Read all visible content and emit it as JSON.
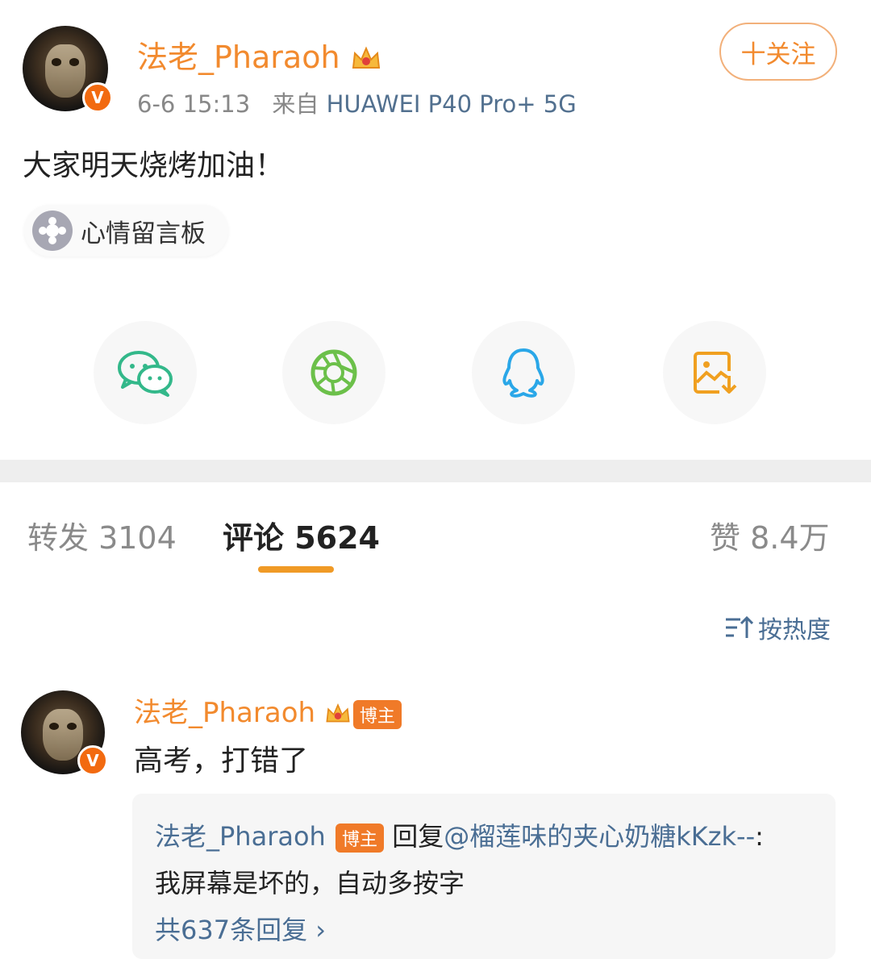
{
  "post": {
    "author": "法老_Pharaoh",
    "time": "6-6 15:13",
    "source_prefix": "来自",
    "device": "HUAWEI P40 Pro+ 5G",
    "follow_label": "十关注",
    "text": "大家明天烧烤加油！",
    "topic": "心情留言板",
    "verified_badge": "V"
  },
  "share": [
    {
      "name": "wechat-icon",
      "color": "#33b88a"
    },
    {
      "name": "moments-icon",
      "color": "#6cc04a"
    },
    {
      "name": "qq-icon",
      "color": "#2aa7e8"
    },
    {
      "name": "save-image-icon",
      "color": "#f0a020"
    }
  ],
  "tabs": {
    "repost": "转发 3104",
    "comment": "评论 5624",
    "likes": "赞 8.4万"
  },
  "sort_label": "按热度",
  "comment": {
    "author": "法老_Pharaoh",
    "blogger_tag": "博主",
    "text": "高考，打错了",
    "reply": {
      "author": "法老_Pharaoh",
      "blogger_tag": "博主",
      "reply_word": "回复",
      "mention": "@榴莲味的夹心奶糖kKzk--",
      "colon": ":",
      "text": "我屏幕是坏的，自动多按字",
      "count_label": "共637条回复 ›"
    }
  },
  "colors": {
    "accent_orange": "#f28a2e",
    "link_blue": "#4a6e94",
    "tab_underline": "#f09a26"
  }
}
